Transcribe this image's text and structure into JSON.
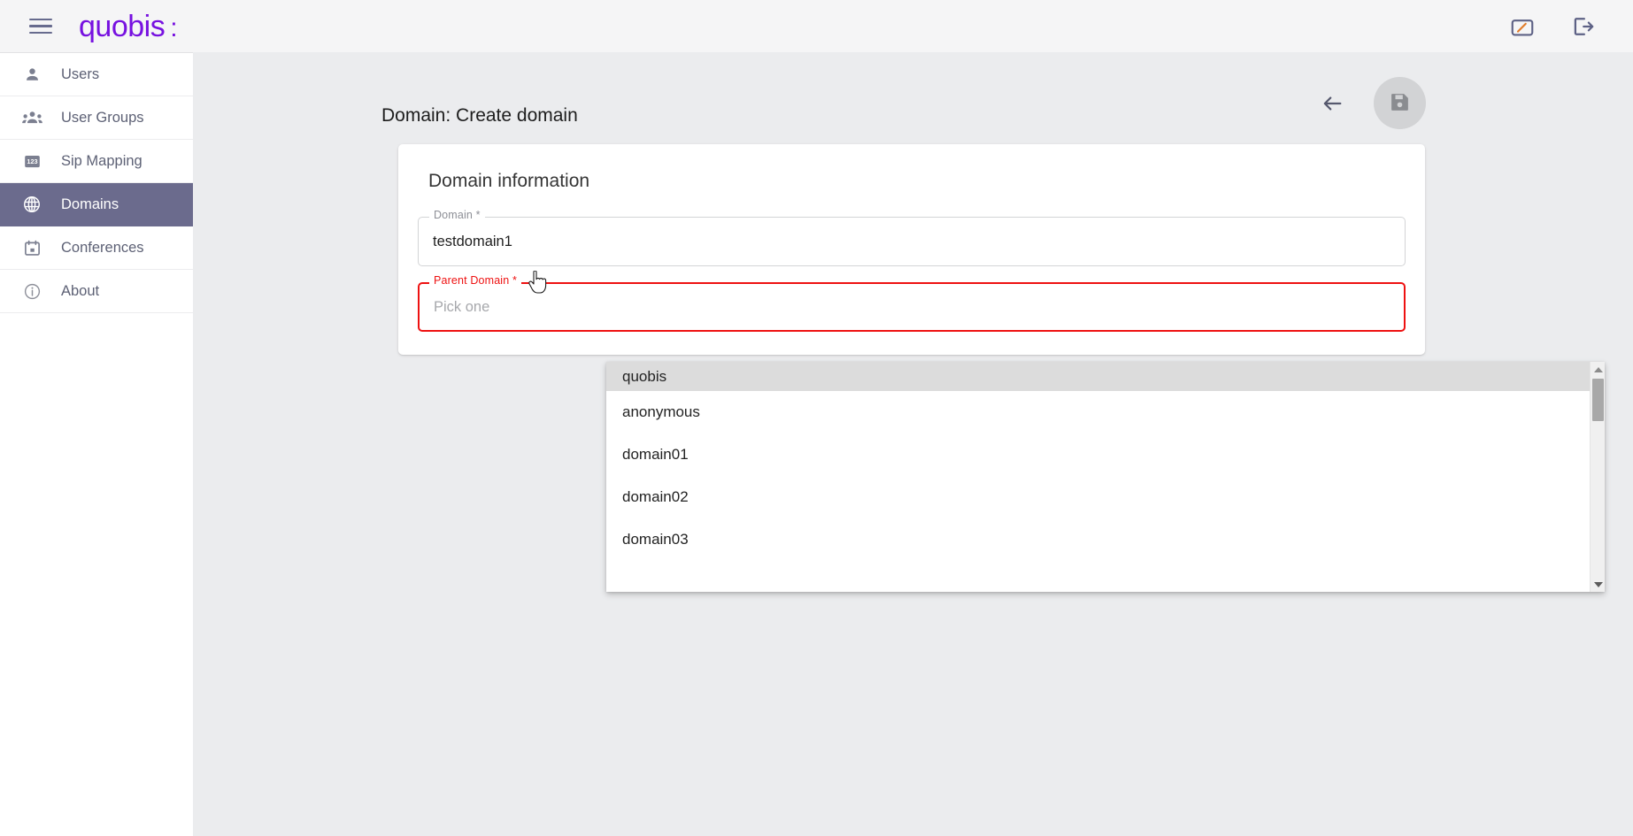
{
  "app": {
    "brand_name": "quobis",
    "brand_dots": ":",
    "accent_color": "#7711e0",
    "active_nav_color": "#6b6b8d",
    "error_color": "#ee1111",
    "background_color": "#ebecee"
  },
  "topbar": {
    "menu_icon": "hamburger-menu-icon",
    "icons": [
      {
        "name": "dashboard-speedometer-icon",
        "label": "Dashboard"
      },
      {
        "name": "logout-icon",
        "label": "Logout"
      }
    ]
  },
  "sidebar": {
    "items": [
      {
        "label": "Users",
        "icon": "person-icon",
        "active": false
      },
      {
        "label": "User Groups",
        "icon": "people-group-icon",
        "active": false
      },
      {
        "label": "Sip Mapping",
        "icon": "numbers-123-icon",
        "active": false
      },
      {
        "label": "Domains",
        "icon": "globe-icon",
        "active": true
      },
      {
        "label": "Conferences",
        "icon": "calendar-icon",
        "active": false
      },
      {
        "label": "About",
        "icon": "info-circle-icon",
        "active": false
      }
    ]
  },
  "page": {
    "title": "Domain: Create domain",
    "back_label": "Back",
    "save_label": "Save",
    "save_icon": "floppy-disk-save-icon",
    "back_icon": "arrow-left-icon",
    "save_disabled": true
  },
  "card": {
    "title": "Domain information",
    "fields": [
      {
        "label": "Domain *",
        "value": "testdomain1",
        "placeholder": "",
        "state": "normal"
      },
      {
        "label": "Parent Domain *",
        "value": "",
        "placeholder": "Pick one",
        "state": "error"
      }
    ]
  },
  "dropdown": {
    "open": true,
    "highlighted_index": 0,
    "options": [
      {
        "label": "quobis"
      },
      {
        "label": "anonymous"
      },
      {
        "label": "domain01"
      },
      {
        "label": "domain02"
      },
      {
        "label": "domain03"
      }
    ],
    "scrollbar": {
      "up_icon": "scroll-up-arrow-icon",
      "down_icon": "scroll-down-arrow-icon"
    }
  }
}
